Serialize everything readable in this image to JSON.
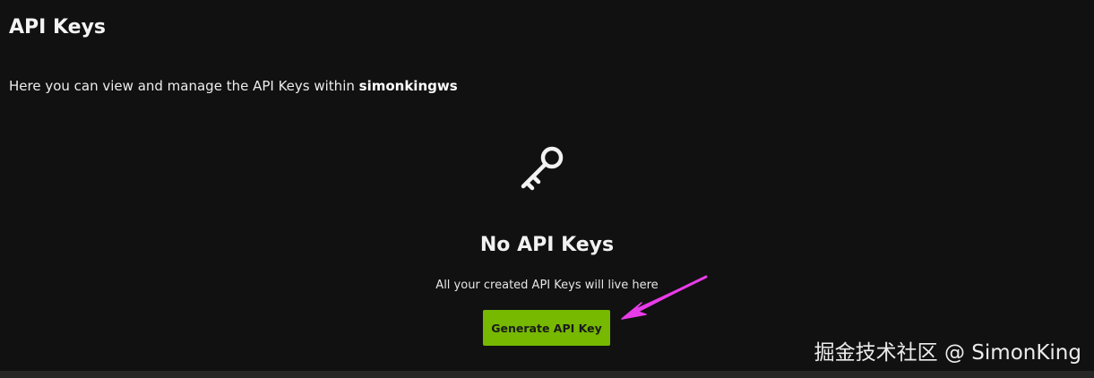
{
  "header": {
    "title": "API Keys"
  },
  "description": {
    "prefix": "Here you can view and manage the API Keys within ",
    "org_name": "simonkingws"
  },
  "empty_state": {
    "icon": "key-icon",
    "title": "No API Keys",
    "message": "All your created API Keys will live here",
    "button_label": "Generate API Key"
  },
  "annotation": {
    "icon": "arrow-icon",
    "color": "#e83ce8"
  },
  "watermark": {
    "text": "掘金技术社区 @ SimonKing"
  },
  "colors": {
    "background": "#111111",
    "accent": "#76b900",
    "text": "#f2f2f2"
  }
}
